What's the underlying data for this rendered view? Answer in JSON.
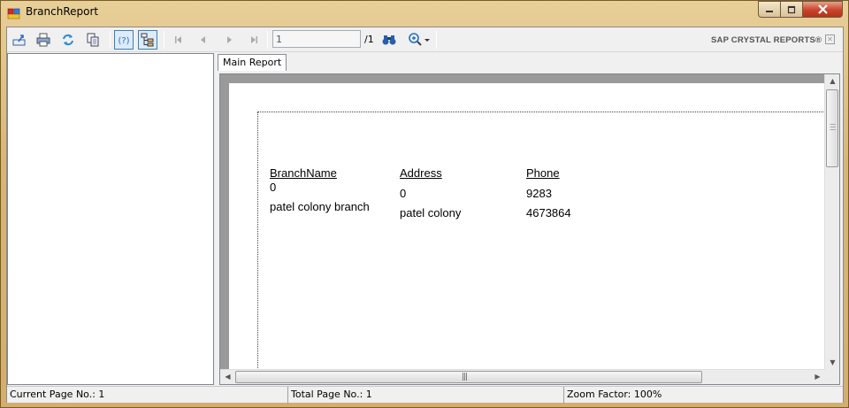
{
  "window": {
    "title": "BranchReport"
  },
  "toolbar": {
    "buttons": [
      {
        "name": "export-icon"
      },
      {
        "name": "print-icon"
      },
      {
        "name": "refresh-icon"
      },
      {
        "name": "copy-icon"
      },
      {
        "name": "help-icon"
      },
      {
        "name": "toggle-group-tree-icon"
      },
      {
        "name": "first-page-icon"
      },
      {
        "name": "previous-page-icon"
      },
      {
        "name": "next-page-icon"
      },
      {
        "name": "last-page-icon"
      }
    ],
    "page_input_value": "1",
    "page_total": "/1",
    "brand": "SAP CRYSTAL REPORTS®"
  },
  "tab": {
    "label": "Main Report"
  },
  "report": {
    "headers": [
      "BranchName",
      "Address",
      "Phone"
    ],
    "rows": [
      {
        "branch": "0",
        "address": "0",
        "phone": "9283"
      },
      {
        "branch": "patel colony branch",
        "address": "patel colony",
        "phone": "4673864"
      }
    ]
  },
  "statusbar": {
    "current_page": "Current Page No.: 1",
    "total_page": "Total Page No.: 1",
    "zoom": "Zoom Factor: 100%"
  }
}
